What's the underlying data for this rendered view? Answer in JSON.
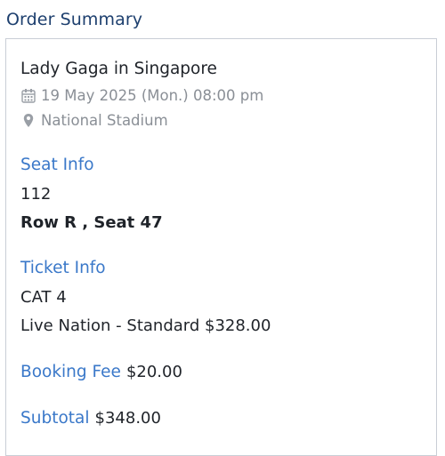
{
  "page": {
    "title": "Order Summary"
  },
  "event": {
    "title": "Lady Gaga in Singapore",
    "datetime": "19 May 2025 (Mon.) 08:00 pm",
    "venue": "National Stadium",
    "date_icon": "calendar-icon",
    "venue_icon": "location-pin-icon"
  },
  "seat_info": {
    "heading": "Seat Info",
    "section": "112",
    "row_seat": "Row R , Seat 47"
  },
  "ticket_info": {
    "heading": "Ticket Info",
    "category": "CAT 4",
    "type_price": "Live Nation - Standard $328.00"
  },
  "booking_fee": {
    "label": "Booking Fee",
    "value": "$20.00"
  },
  "subtotal": {
    "label": "Subtotal",
    "value": "$348.00"
  },
  "colors": {
    "heading_blue": "#3a78c9",
    "title_navy": "#1d3f6e",
    "meta_gray": "#8a8f96"
  }
}
